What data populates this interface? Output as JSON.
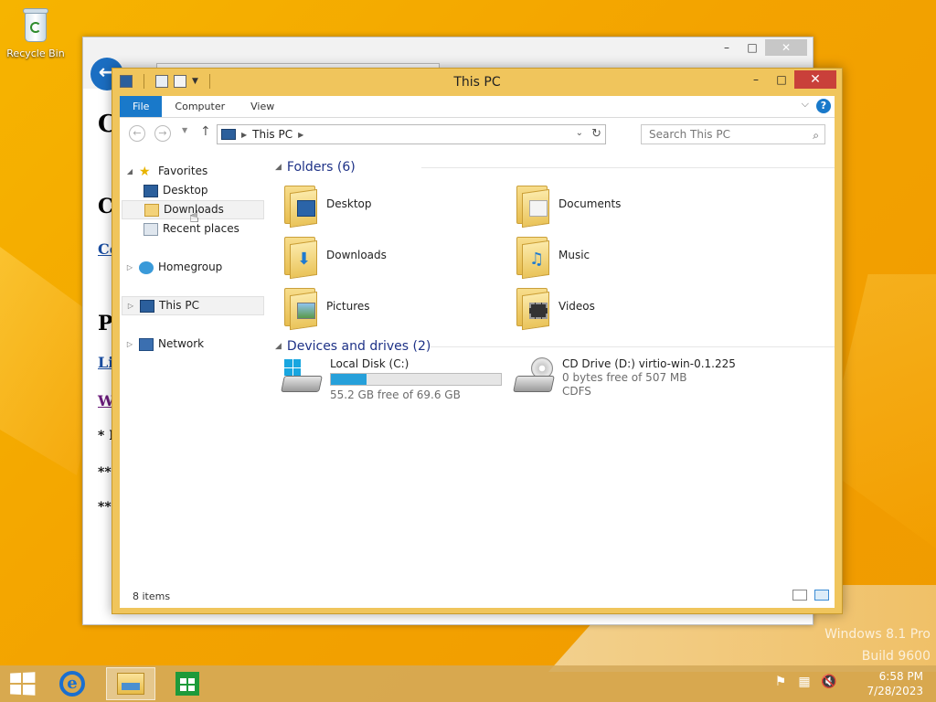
{
  "desktop": {
    "recycle_bin_label": "Recycle Bin",
    "watermark_line1": "Windows 8.1 Pro",
    "watermark_line2": "Build 9600"
  },
  "ie_window": {
    "partial_text": [
      "C",
      "C",
      "Co",
      "P",
      "Li",
      "W",
      "* I",
      "**",
      "**"
    ]
  },
  "explorer": {
    "title": "This PC",
    "ribbon_tabs": [
      "File",
      "Computer",
      "View"
    ],
    "help_label": "?",
    "address": {
      "crumb": "This PC"
    },
    "search_placeholder": "Search This PC",
    "nav": {
      "favorites": "Favorites",
      "desktop": "Desktop",
      "downloads": "Downloads",
      "recent": "Recent places",
      "homegroup": "Homegroup",
      "this_pc": "This PC",
      "network": "Network"
    },
    "folders_header": "Folders (6)",
    "folders": [
      "Desktop",
      "Documents",
      "Downloads",
      "Music",
      "Pictures",
      "Videos"
    ],
    "devices_header": "Devices and drives (2)",
    "drives": [
      {
        "name": "Local Disk (C:)",
        "free": "55.2 GB free of 69.6 GB",
        "used_fraction": 0.207
      },
      {
        "name": "CD Drive (D:) virtio-win-0.1.225",
        "free": "0 bytes free of 507 MB",
        "fs": "CDFS"
      }
    ],
    "status": "8 items"
  },
  "taskbar": {
    "time": "6:58 PM",
    "date": "7/28/2023",
    "ie_glyph": "e"
  },
  "colors": {
    "accent": "#1979ca",
    "window_frame": "#f0c55c",
    "close": "#c9403a",
    "drive_bar": "#26a0da"
  }
}
